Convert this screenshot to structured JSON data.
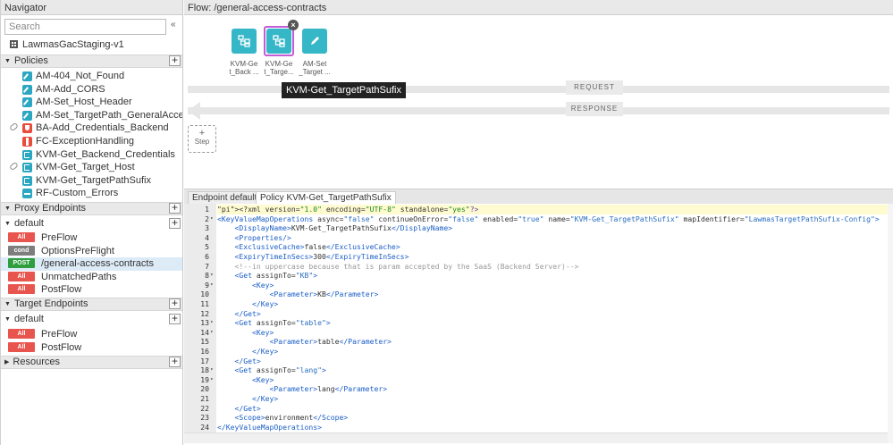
{
  "navigator": {
    "title": "Navigator",
    "collapse_label": "«",
    "search_placeholder": "Search",
    "proxy_name": "LawmasGacStaging-v1",
    "sections": {
      "policies": "Policies",
      "proxy_endpoints": "Proxy Endpoints",
      "target_endpoints": "Target Endpoints",
      "resources": "Resources"
    },
    "policies": [
      {
        "label": "AM-404_Not_Found",
        "icon": "assign-message-icon",
        "linked": false
      },
      {
        "label": "AM-Add_CORS",
        "icon": "assign-message-icon",
        "linked": false
      },
      {
        "label": "AM-Set_Host_Header",
        "icon": "assign-message-icon",
        "linked": false
      },
      {
        "label": "AM-Set_TargetPath_GeneralAcce...",
        "icon": "assign-message-icon",
        "linked": false
      },
      {
        "label": "BA-Add_Credentials_Backend",
        "icon": "basic-auth-icon",
        "linked": true
      },
      {
        "label": "FC-ExceptionHandling",
        "icon": "flow-callout-icon",
        "linked": false
      },
      {
        "label": "KVM-Get_Backend_Credentials",
        "icon": "kvm-icon",
        "linked": false
      },
      {
        "label": "KVM-Get_Target_Host",
        "icon": "kvm-icon",
        "linked": true
      },
      {
        "label": "KVM-Get_TargetPathSufix",
        "icon": "kvm-icon",
        "linked": false
      },
      {
        "label": "RF-Custom_Errors",
        "icon": "raise-fault-icon",
        "linked": false
      }
    ],
    "proxy_endpoint_group": "default",
    "proxy_flows": [
      {
        "badge": "All",
        "label": "PreFlow"
      },
      {
        "badge": "cond",
        "label": "OptionsPreFlight"
      },
      {
        "badge": "POST",
        "label": "/general-access-contracts",
        "selected": true
      },
      {
        "badge": "All",
        "label": "UnmatchedPaths"
      },
      {
        "badge": "All",
        "label": "PostFlow"
      }
    ],
    "target_endpoint_group": "default",
    "target_flows": [
      {
        "badge": "All",
        "label": "PreFlow"
      },
      {
        "badge": "All",
        "label": "PostFlow"
      }
    ]
  },
  "flow": {
    "title": "Flow: /general-access-contracts",
    "request_label": "REQUEST",
    "response_label": "RESPONSE",
    "add_step": {
      "plus": "+",
      "label": "Step"
    },
    "steps": [
      {
        "label1": "KVM-Ge",
        "label2": "t_Back ...",
        "icon": "kvm-icon"
      },
      {
        "label1": "KVM-Ge",
        "label2": "t_Targe...",
        "icon": "kvm-icon"
      },
      {
        "label1": "AM-Set",
        "label2": "_Target ...",
        "icon": "assign-message-icon"
      }
    ],
    "tooltip": "KVM-Get_TargetPathSufix",
    "remove_glyph": "×"
  },
  "editor": {
    "tabs": [
      "Endpoint default",
      "Policy KVM-Get_TargetPathSufix"
    ],
    "active_tab": 1,
    "lines": [
      {
        "n": "1",
        "fold": "",
        "text": "<?xml version=\"1.0\" encoding=\"UTF-8\" standalone=\"yes\"?>"
      },
      {
        "n": "2",
        "fold": "▾",
        "text": "<KeyValueMapOperations async=\"false\" continueOnError=\"false\" enabled=\"true\" name=\"KVM-Get_TargetPathSufix\" mapIdentifier=\"LawmasTargetPathSufix-Config\">"
      },
      {
        "n": "3",
        "fold": "",
        "text": "    <DisplayName>KVM-Get_TargetPathSufix</DisplayName>"
      },
      {
        "n": "4",
        "fold": "",
        "text": "    <Properties/>"
      },
      {
        "n": "5",
        "fold": "",
        "text": "    <ExclusiveCache>false</ExclusiveCache>"
      },
      {
        "n": "6",
        "fold": "",
        "text": "    <ExpiryTimeInSecs>300</ExpiryTimeInSecs>"
      },
      {
        "n": "7",
        "fold": "",
        "text": "    <!--in uppercase because that is param accepted by the SaaS (Backend Server)-->"
      },
      {
        "n": "8",
        "fold": "▾",
        "text": "    <Get assignTo=\"KB\">"
      },
      {
        "n": "9",
        "fold": "▾",
        "text": "        <Key>"
      },
      {
        "n": "10",
        "fold": "",
        "text": "            <Parameter>KB</Parameter>"
      },
      {
        "n": "11",
        "fold": "",
        "text": "        </Key>"
      },
      {
        "n": "12",
        "fold": "",
        "text": "    </Get>"
      },
      {
        "n": "13",
        "fold": "▾",
        "text": "    <Get assignTo=\"table\">"
      },
      {
        "n": "14",
        "fold": "▾",
        "text": "        <Key>"
      },
      {
        "n": "15",
        "fold": "",
        "text": "            <Parameter>table</Parameter>"
      },
      {
        "n": "16",
        "fold": "",
        "text": "        </Key>"
      },
      {
        "n": "17",
        "fold": "",
        "text": "    </Get>"
      },
      {
        "n": "18",
        "fold": "▾",
        "text": "    <Get assignTo=\"lang\">"
      },
      {
        "n": "19",
        "fold": "▾",
        "text": "        <Key>"
      },
      {
        "n": "20",
        "fold": "",
        "text": "            <Parameter>lang</Parameter>"
      },
      {
        "n": "21",
        "fold": "",
        "text": "        </Key>"
      },
      {
        "n": "22",
        "fold": "",
        "text": "    </Get>"
      },
      {
        "n": "23",
        "fold": "",
        "text": "    <Scope>environment</Scope>"
      },
      {
        "n": "24",
        "fold": "",
        "text": "</KeyValueMapOperations>"
      }
    ]
  },
  "colors": {
    "accent_teal": "#35b7c8",
    "selection_purple": "#c45bd8",
    "badge_all": "#e8554e",
    "badge_cond": "#7e7e7e",
    "badge_post": "#2e9e3e"
  }
}
